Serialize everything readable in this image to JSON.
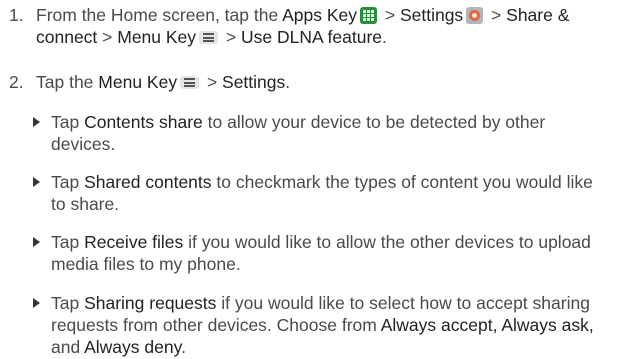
{
  "steps": [
    {
      "number": "1.",
      "from": "From the Home screen, tap the ",
      "apps_key": "Apps Key",
      "gt1": " > ",
      "settings": "Settings",
      "gt2": " > ",
      "share_connect": "Share & connect",
      "gt3": " > ",
      "menu_key": "Menu Key",
      "gt4": " > ",
      "use_dlna": "Use DLNA feature",
      "end": "."
    },
    {
      "number": "2.",
      "tap": "Tap the ",
      "menu_key": "Menu Key",
      "gt": " > ",
      "settings": "Settings",
      "end": "."
    }
  ],
  "bullets": [
    {
      "tap": "Tap ",
      "term": "Contents share",
      "rest": " to allow your device to be detected by other devices."
    },
    {
      "tap": "Tap ",
      "term": "Shared contents",
      "rest": " to checkmark the types of content you would like to share."
    },
    {
      "tap": "Tap ",
      "term": "Receive files",
      "rest": " if you would like to allow the other devices to upload media files to my phone."
    },
    {
      "tap": "Tap ",
      "term": "Sharing requests",
      "rest": " if you would like to select how to accept sharing requests from other devices. Choose from ",
      "opt1": "Always accept,",
      "sep": " ",
      "opt2": "Always ask,",
      "and": " and ",
      "opt3": "Always deny",
      "end": "."
    }
  ],
  "icons": {
    "apps": "apps-grid-icon",
    "settings": "settings-gear-icon",
    "menu": "menu-key-icon"
  }
}
